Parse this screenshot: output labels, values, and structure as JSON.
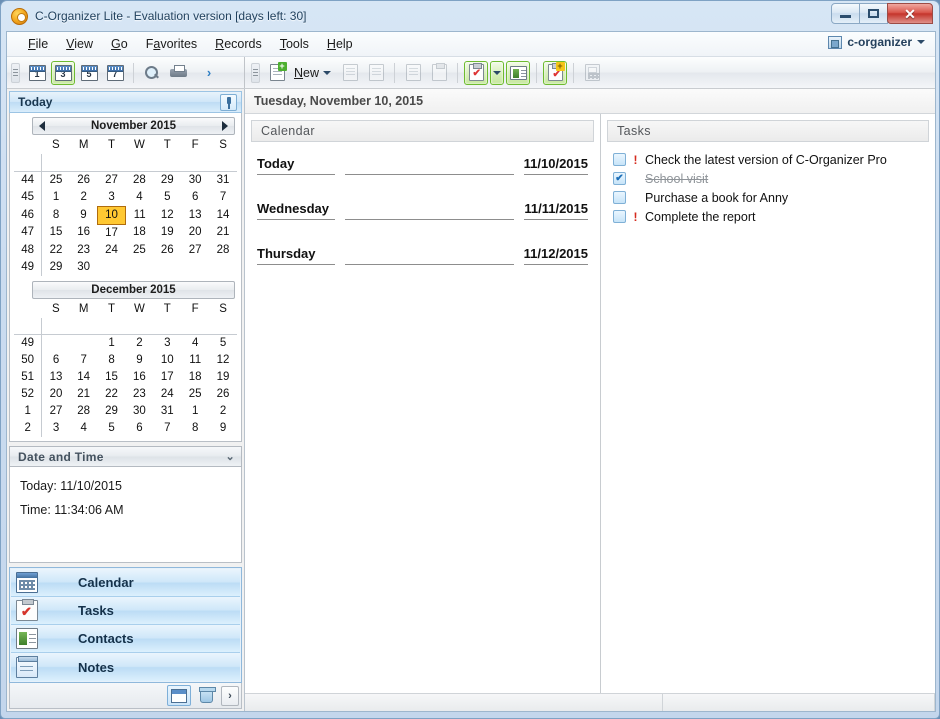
{
  "window": {
    "title": "C-Organizer Lite - Evaluation version [days left: 30]",
    "minimize_label": "",
    "maximize_label": "",
    "close_label": "✕"
  },
  "menubar": {
    "items": [
      {
        "label": "File",
        "accel": "F"
      },
      {
        "label": "View",
        "accel": "V"
      },
      {
        "label": "Go",
        "accel": "G"
      },
      {
        "label": "Favorites",
        "accel": "a"
      },
      {
        "label": "Records",
        "accel": "R"
      },
      {
        "label": "Tools",
        "accel": "T"
      },
      {
        "label": "Help",
        "accel": "H"
      }
    ],
    "window_menu_label": "c-organizer"
  },
  "toolbar_left": {
    "buttons": [
      {
        "name": "day-view-1",
        "label": "1",
        "active": false
      },
      {
        "name": "day-view-3",
        "label": "3",
        "active": true
      },
      {
        "name": "day-view-5",
        "label": "5",
        "active": false
      },
      {
        "name": "day-view-7",
        "label": "7",
        "active": false
      }
    ],
    "search_label": "",
    "print_label": "",
    "overflow_label": "›"
  },
  "toolbar_right": {
    "new_label": "New",
    "new_accel": "N",
    "edit_label": "",
    "delete_label": "",
    "tasks_label": "",
    "clipboard_label": "",
    "calc_label": ""
  },
  "sidebar": {
    "today_header": "Today",
    "pin_label": "",
    "month1": {
      "title": "November 2015",
      "prev_label": "◀",
      "next_label": "▶",
      "daynames": [
        "S",
        "M",
        "T",
        "W",
        "T",
        "F",
        "S"
      ],
      "weeks": [
        {
          "wk": "44",
          "days": [
            {
              "d": "25",
              "out": true
            },
            {
              "d": "26",
              "out": true
            },
            {
              "d": "27",
              "out": true
            },
            {
              "d": "28",
              "out": true
            },
            {
              "d": "29",
              "out": true
            },
            {
              "d": "30",
              "out": true
            },
            {
              "d": "31",
              "out": true
            }
          ]
        },
        {
          "wk": "45",
          "days": [
            {
              "d": "1"
            },
            {
              "d": "2"
            },
            {
              "d": "3"
            },
            {
              "d": "4"
            },
            {
              "d": "5"
            },
            {
              "d": "6"
            },
            {
              "d": "7"
            }
          ]
        },
        {
          "wk": "46",
          "days": [
            {
              "d": "8"
            },
            {
              "d": "9"
            },
            {
              "d": "10",
              "today": true
            },
            {
              "d": "11"
            },
            {
              "d": "12"
            },
            {
              "d": "13"
            },
            {
              "d": "14"
            }
          ]
        },
        {
          "wk": "47",
          "days": [
            {
              "d": "15"
            },
            {
              "d": "16"
            },
            {
              "d": "17"
            },
            {
              "d": "18"
            },
            {
              "d": "19"
            },
            {
              "d": "20"
            },
            {
              "d": "21"
            }
          ]
        },
        {
          "wk": "48",
          "days": [
            {
              "d": "22"
            },
            {
              "d": "23"
            },
            {
              "d": "24"
            },
            {
              "d": "25"
            },
            {
              "d": "26"
            },
            {
              "d": "27"
            },
            {
              "d": "28"
            }
          ]
        },
        {
          "wk": "49",
          "days": [
            {
              "d": "29"
            },
            {
              "d": "30"
            },
            {
              "d": ""
            },
            {
              "d": ""
            },
            {
              "d": ""
            },
            {
              "d": ""
            },
            {
              "d": ""
            }
          ]
        }
      ]
    },
    "month2": {
      "title": "December 2015",
      "daynames": [
        "S",
        "M",
        "T",
        "W",
        "T",
        "F",
        "S"
      ],
      "weeks": [
        {
          "wk": "49",
          "days": [
            {
              "d": ""
            },
            {
              "d": ""
            },
            {
              "d": "1"
            },
            {
              "d": "2"
            },
            {
              "d": "3"
            },
            {
              "d": "4"
            },
            {
              "d": "5"
            }
          ]
        },
        {
          "wk": "50",
          "days": [
            {
              "d": "6"
            },
            {
              "d": "7"
            },
            {
              "d": "8"
            },
            {
              "d": "9"
            },
            {
              "d": "10"
            },
            {
              "d": "11"
            },
            {
              "d": "12"
            }
          ]
        },
        {
          "wk": "51",
          "days": [
            {
              "d": "13"
            },
            {
              "d": "14"
            },
            {
              "d": "15"
            },
            {
              "d": "16"
            },
            {
              "d": "17"
            },
            {
              "d": "18"
            },
            {
              "d": "19"
            }
          ]
        },
        {
          "wk": "52",
          "days": [
            {
              "d": "20"
            },
            {
              "d": "21"
            },
            {
              "d": "22"
            },
            {
              "d": "23"
            },
            {
              "d": "24"
            },
            {
              "d": "25"
            },
            {
              "d": "26"
            }
          ]
        },
        {
          "wk": "1",
          "days": [
            {
              "d": "27"
            },
            {
              "d": "28"
            },
            {
              "d": "29"
            },
            {
              "d": "30"
            },
            {
              "d": "31"
            },
            {
              "d": "1",
              "out": true
            },
            {
              "d": "2",
              "out": true
            }
          ]
        },
        {
          "wk": "2",
          "days": [
            {
              "d": "3",
              "out": true
            },
            {
              "d": "4",
              "out": true
            },
            {
              "d": "5",
              "out": true
            },
            {
              "d": "6",
              "out": true
            },
            {
              "d": "7",
              "out": true
            },
            {
              "d": "8",
              "out": true
            },
            {
              "d": "9",
              "out": true
            }
          ]
        }
      ]
    },
    "datetime": {
      "header": "Date and Time",
      "collapse_label": "⌄",
      "today_line": "Today: 11/10/2015",
      "time_line": "Time: 11:34:06 AM"
    },
    "nav_items": [
      {
        "label": "Calendar",
        "icon": "calendar-icon"
      },
      {
        "label": "Tasks",
        "icon": "tasks-icon"
      },
      {
        "label": "Contacts",
        "icon": "contacts-icon"
      },
      {
        "label": "Notes",
        "icon": "notes-icon"
      }
    ],
    "nav_footer": {
      "config_label": "",
      "recycle_label": "",
      "expand_label": "›"
    }
  },
  "content": {
    "date_strip": "Tuesday, November 10, 2015",
    "calendar_panel": {
      "header": "Calendar",
      "days": [
        {
          "name": "Today",
          "date": "11/10/2015"
        },
        {
          "name": "Wednesday",
          "date": "11/11/2015"
        },
        {
          "name": "Thursday",
          "date": "11/12/2015"
        }
      ]
    },
    "tasks_panel": {
      "header": "Tasks",
      "items": [
        {
          "text": "Check the latest version of C-Organizer Pro",
          "checked": false,
          "priority": true
        },
        {
          "text": "School visit",
          "checked": true,
          "priority": false
        },
        {
          "text": "Purchase a book for Anny",
          "checked": false,
          "priority": false
        },
        {
          "text": "Complete the report",
          "checked": false,
          "priority": true
        }
      ]
    }
  },
  "colors": {
    "today_highlight": "#ffc832",
    "priority": "#d52b1e",
    "accent": "#bedcf4",
    "active_toolbar": "#6dbb2f"
  }
}
